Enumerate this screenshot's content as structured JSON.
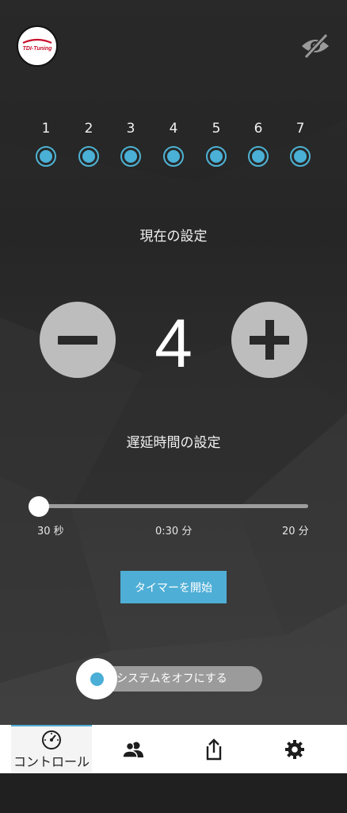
{
  "header": {
    "logo_text": "TDI-Tuning",
    "visibility_icon": "eye-slash-icon"
  },
  "steps": [
    "1",
    "2",
    "3",
    "4",
    "5",
    "6",
    "7"
  ],
  "current_setting": {
    "title": "現在の設定",
    "value": "4",
    "decrease_icon": "minus-icon",
    "increase_icon": "plus-icon"
  },
  "delay": {
    "title": "遅延時間の設定",
    "min_label": "30 秒",
    "current_label": "0:30 分",
    "max_label": "20 分",
    "position": 0
  },
  "timer_button": "タイマーを開始",
  "system_toggle": {
    "label": "システムをオフにする"
  },
  "nav": {
    "items": [
      {
        "label": "コントロール",
        "icon": "gauge-icon",
        "active": true
      },
      {
        "label": "",
        "icon": "users-icon",
        "active": false
      },
      {
        "label": "",
        "icon": "share-icon",
        "active": false
      },
      {
        "label": "",
        "icon": "gear-icon",
        "active": false
      }
    ]
  },
  "colors": {
    "accent": "#4eaed6",
    "button_gray": "#bdbdbd",
    "background": "#2a2a2a"
  }
}
